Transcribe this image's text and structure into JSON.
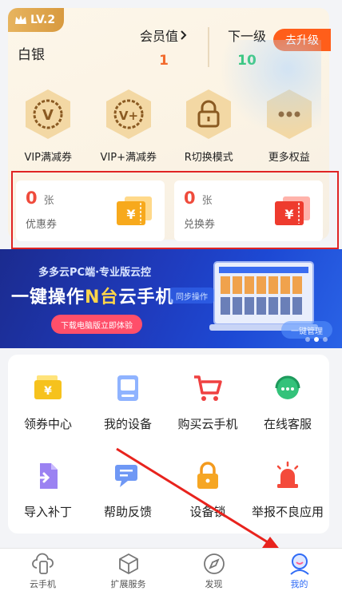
{
  "member": {
    "level_badge": "LV.2",
    "tier_name": "白银",
    "current_label": "会员值",
    "current_value": "1",
    "next_label": "下一级",
    "next_value": "10",
    "upgrade_button": "去升级"
  },
  "benefits": [
    {
      "label": "VIP满减券",
      "icon": "vip-coupon-icon",
      "glyph": "V"
    },
    {
      "label": "VIP+满减券",
      "icon": "vip-plus-coupon-icon",
      "glyph": "V+"
    },
    {
      "label": "R切换模式",
      "icon": "lock-icon"
    },
    {
      "label": "更多权益",
      "icon": "more-icon"
    }
  ],
  "coupons": [
    {
      "count": "0",
      "unit": "张",
      "label": "优惠券",
      "icon": "coupon-ticket-icon"
    },
    {
      "count": "0",
      "unit": "张",
      "label": "兑换券",
      "icon": "exchange-ticket-icon"
    }
  ],
  "banner": {
    "subtitle": "多多云PC端·专业版云控",
    "headline_part1": "一键操作",
    "headline_highlight": "N台",
    "headline_part2": "云手机",
    "cta": "下载电脑版立即体验",
    "chip_left": "同步操作",
    "chip_right": "一键管理"
  },
  "services": [
    {
      "label": "领券中心",
      "icon": "coupon-center-icon"
    },
    {
      "label": "我的设备",
      "icon": "my-device-icon"
    },
    {
      "label": "购买云手机",
      "icon": "shopping-cart-icon"
    },
    {
      "label": "在线客服",
      "icon": "customer-service-icon"
    },
    {
      "label": "导入补丁",
      "icon": "import-patch-icon"
    },
    {
      "label": "帮助反馈",
      "icon": "help-feedback-icon"
    },
    {
      "label": "设备锁",
      "icon": "device-lock-icon"
    },
    {
      "label": "举报不良应用",
      "icon": "report-alarm-icon"
    }
  ],
  "tabs": [
    {
      "label": "云手机",
      "icon": "cloud-phone-icon",
      "active": false
    },
    {
      "label": "扩展服务",
      "icon": "extension-cube-icon",
      "active": false
    },
    {
      "label": "发现",
      "icon": "compass-icon",
      "active": false
    },
    {
      "label": "我的",
      "icon": "profile-icon",
      "active": true
    }
  ],
  "colors": {
    "accent": "#ff5e1a",
    "active_tab": "#2f6bf6",
    "coupon_number": "#ef4b3c",
    "highlight_border": "#e02424",
    "gold": "#e7b45f"
  }
}
